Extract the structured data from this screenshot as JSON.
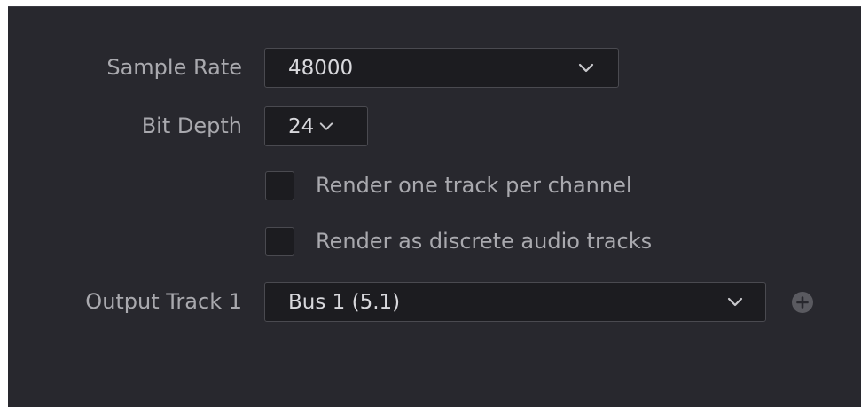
{
  "audio_settings": {
    "sample_rate": {
      "label": "Sample Rate",
      "value": "48000"
    },
    "bit_depth": {
      "label": "Bit Depth",
      "value": "24"
    },
    "render_per_channel": {
      "label": "Render one track per channel",
      "checked": false
    },
    "render_discrete": {
      "label": "Render as discrete audio tracks",
      "checked": false
    },
    "output_track": {
      "label": "Output Track 1",
      "value": "Bus 1 (5.1)"
    }
  },
  "icons": {
    "dropdown": "chevron-down-icon",
    "add": "plus-icon"
  },
  "colors": {
    "panel_bg": "#28282e",
    "field_bg": "#1c1c20",
    "label_text": "#a9a9ae",
    "value_text": "#d8d8dc"
  }
}
